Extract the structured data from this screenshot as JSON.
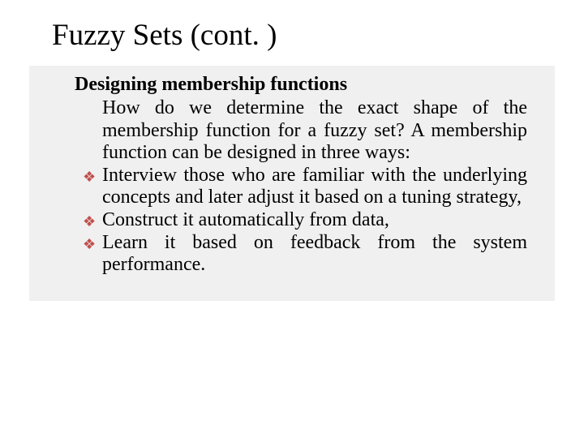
{
  "title": "Fuzzy Sets (cont. )",
  "subheading": "Designing membership functions",
  "intro": "How do we determine the exact shape of the membership function for a fuzzy set? A membership function can be designed in three ways:",
  "bullets": [
    "Interview those who are familiar with the underlying concepts and later adjust it based on a tuning strategy,",
    "Construct it automatically from data,",
    "Learn it based on feedback from the system performance."
  ],
  "bullet_glyph": "❖"
}
